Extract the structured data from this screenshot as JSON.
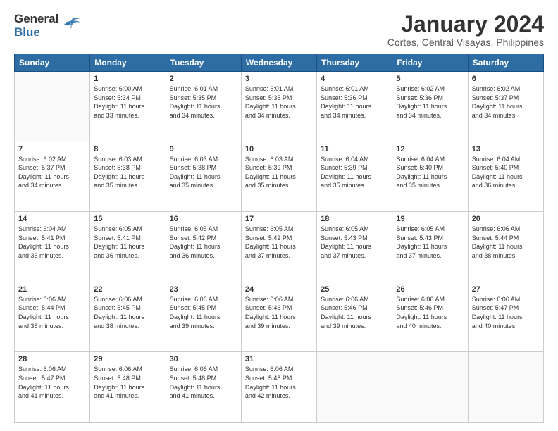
{
  "header": {
    "logo_general": "General",
    "logo_blue": "Blue",
    "month_title": "January 2024",
    "location": "Cortes, Central Visayas, Philippines"
  },
  "days_of_week": [
    "Sunday",
    "Monday",
    "Tuesday",
    "Wednesday",
    "Thursday",
    "Friday",
    "Saturday"
  ],
  "weeks": [
    [
      {
        "day": "",
        "sunrise": "",
        "sunset": "",
        "daylight": ""
      },
      {
        "day": "1",
        "sunrise": "Sunrise: 6:00 AM",
        "sunset": "Sunset: 5:34 PM",
        "daylight": "Daylight: 11 hours and 33 minutes."
      },
      {
        "day": "2",
        "sunrise": "Sunrise: 6:01 AM",
        "sunset": "Sunset: 5:35 PM",
        "daylight": "Daylight: 11 hours and 34 minutes."
      },
      {
        "day": "3",
        "sunrise": "Sunrise: 6:01 AM",
        "sunset": "Sunset: 5:35 PM",
        "daylight": "Daylight: 11 hours and 34 minutes."
      },
      {
        "day": "4",
        "sunrise": "Sunrise: 6:01 AM",
        "sunset": "Sunset: 5:36 PM",
        "daylight": "Daylight: 11 hours and 34 minutes."
      },
      {
        "day": "5",
        "sunrise": "Sunrise: 6:02 AM",
        "sunset": "Sunset: 5:36 PM",
        "daylight": "Daylight: 11 hours and 34 minutes."
      },
      {
        "day": "6",
        "sunrise": "Sunrise: 6:02 AM",
        "sunset": "Sunset: 5:37 PM",
        "daylight": "Daylight: 11 hours and 34 minutes."
      }
    ],
    [
      {
        "day": "7",
        "sunrise": "Sunrise: 6:02 AM",
        "sunset": "Sunset: 5:37 PM",
        "daylight": "Daylight: 11 hours and 34 minutes."
      },
      {
        "day": "8",
        "sunrise": "Sunrise: 6:03 AM",
        "sunset": "Sunset: 5:38 PM",
        "daylight": "Daylight: 11 hours and 35 minutes."
      },
      {
        "day": "9",
        "sunrise": "Sunrise: 6:03 AM",
        "sunset": "Sunset: 5:38 PM",
        "daylight": "Daylight: 11 hours and 35 minutes."
      },
      {
        "day": "10",
        "sunrise": "Sunrise: 6:03 AM",
        "sunset": "Sunset: 5:39 PM",
        "daylight": "Daylight: 11 hours and 35 minutes."
      },
      {
        "day": "11",
        "sunrise": "Sunrise: 6:04 AM",
        "sunset": "Sunset: 5:39 PM",
        "daylight": "Daylight: 11 hours and 35 minutes."
      },
      {
        "day": "12",
        "sunrise": "Sunrise: 6:04 AM",
        "sunset": "Sunset: 5:40 PM",
        "daylight": "Daylight: 11 hours and 35 minutes."
      },
      {
        "day": "13",
        "sunrise": "Sunrise: 6:04 AM",
        "sunset": "Sunset: 5:40 PM",
        "daylight": "Daylight: 11 hours and 36 minutes."
      }
    ],
    [
      {
        "day": "14",
        "sunrise": "Sunrise: 6:04 AM",
        "sunset": "Sunset: 5:41 PM",
        "daylight": "Daylight: 11 hours and 36 minutes."
      },
      {
        "day": "15",
        "sunrise": "Sunrise: 6:05 AM",
        "sunset": "Sunset: 5:41 PM",
        "daylight": "Daylight: 11 hours and 36 minutes."
      },
      {
        "day": "16",
        "sunrise": "Sunrise: 6:05 AM",
        "sunset": "Sunset: 5:42 PM",
        "daylight": "Daylight: 11 hours and 36 minutes."
      },
      {
        "day": "17",
        "sunrise": "Sunrise: 6:05 AM",
        "sunset": "Sunset: 5:42 PM",
        "daylight": "Daylight: 11 hours and 37 minutes."
      },
      {
        "day": "18",
        "sunrise": "Sunrise: 6:05 AM",
        "sunset": "Sunset: 5:43 PM",
        "daylight": "Daylight: 11 hours and 37 minutes."
      },
      {
        "day": "19",
        "sunrise": "Sunrise: 6:05 AM",
        "sunset": "Sunset: 5:43 PM",
        "daylight": "Daylight: 11 hours and 37 minutes."
      },
      {
        "day": "20",
        "sunrise": "Sunrise: 6:06 AM",
        "sunset": "Sunset: 5:44 PM",
        "daylight": "Daylight: 11 hours and 38 minutes."
      }
    ],
    [
      {
        "day": "21",
        "sunrise": "Sunrise: 6:06 AM",
        "sunset": "Sunset: 5:44 PM",
        "daylight": "Daylight: 11 hours and 38 minutes."
      },
      {
        "day": "22",
        "sunrise": "Sunrise: 6:06 AM",
        "sunset": "Sunset: 5:45 PM",
        "daylight": "Daylight: 11 hours and 38 minutes."
      },
      {
        "day": "23",
        "sunrise": "Sunrise: 6:06 AM",
        "sunset": "Sunset: 5:45 PM",
        "daylight": "Daylight: 11 hours and 39 minutes."
      },
      {
        "day": "24",
        "sunrise": "Sunrise: 6:06 AM",
        "sunset": "Sunset: 5:46 PM",
        "daylight": "Daylight: 11 hours and 39 minutes."
      },
      {
        "day": "25",
        "sunrise": "Sunrise: 6:06 AM",
        "sunset": "Sunset: 5:46 PM",
        "daylight": "Daylight: 11 hours and 39 minutes."
      },
      {
        "day": "26",
        "sunrise": "Sunrise: 6:06 AM",
        "sunset": "Sunset: 5:46 PM",
        "daylight": "Daylight: 11 hours and 40 minutes."
      },
      {
        "day": "27",
        "sunrise": "Sunrise: 6:06 AM",
        "sunset": "Sunset: 5:47 PM",
        "daylight": "Daylight: 11 hours and 40 minutes."
      }
    ],
    [
      {
        "day": "28",
        "sunrise": "Sunrise: 6:06 AM",
        "sunset": "Sunset: 5:47 PM",
        "daylight": "Daylight: 11 hours and 41 minutes."
      },
      {
        "day": "29",
        "sunrise": "Sunrise: 6:06 AM",
        "sunset": "Sunset: 5:48 PM",
        "daylight": "Daylight: 11 hours and 41 minutes."
      },
      {
        "day": "30",
        "sunrise": "Sunrise: 6:06 AM",
        "sunset": "Sunset: 5:48 PM",
        "daylight": "Daylight: 11 hours and 41 minutes."
      },
      {
        "day": "31",
        "sunrise": "Sunrise: 6:06 AM",
        "sunset": "Sunset: 5:48 PM",
        "daylight": "Daylight: 11 hours and 42 minutes."
      },
      {
        "day": "",
        "sunrise": "",
        "sunset": "",
        "daylight": ""
      },
      {
        "day": "",
        "sunrise": "",
        "sunset": "",
        "daylight": ""
      },
      {
        "day": "",
        "sunrise": "",
        "sunset": "",
        "daylight": ""
      }
    ]
  ]
}
